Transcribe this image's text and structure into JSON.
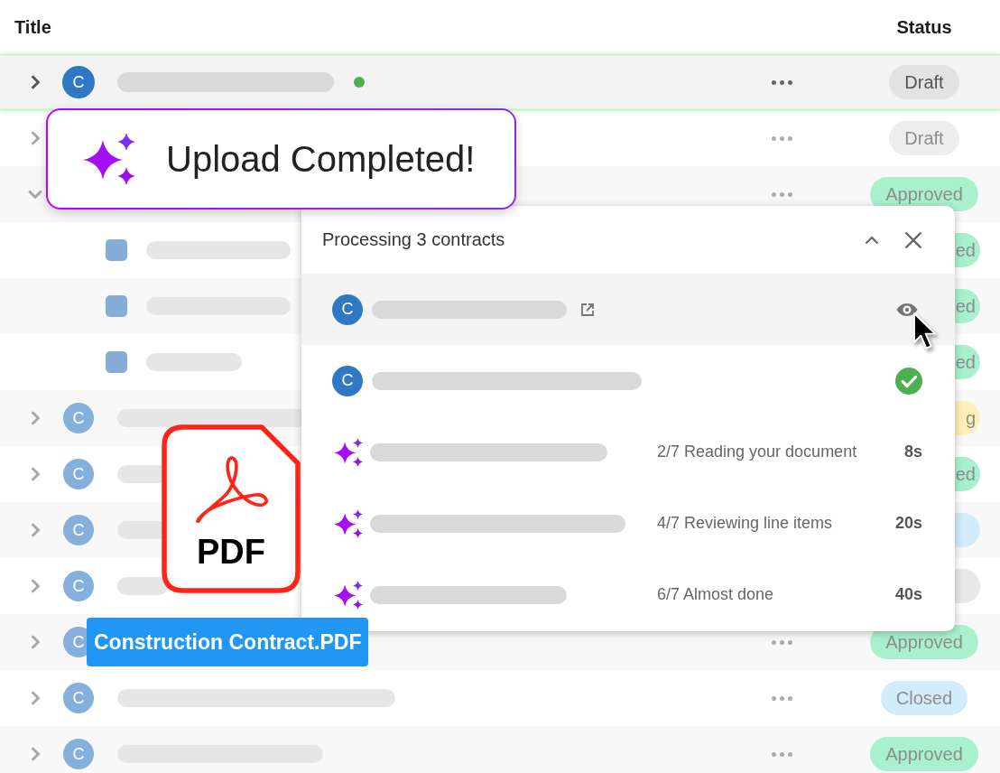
{
  "table": {
    "columns": [
      {
        "label": "Title"
      },
      {
        "label": "Status"
      }
    ],
    "rows": [
      {
        "highlighted": true,
        "expanded": false,
        "unread": true,
        "avatar": "C",
        "status": {
          "text": "Draft",
          "color": "#e3e3e3"
        }
      },
      {
        "highlighted": false,
        "expanded": false,
        "unread": false,
        "status": {
          "text": "Draft",
          "color": "#ededed"
        }
      },
      {
        "highlighted": false,
        "expanded": true,
        "unread": false,
        "status": {
          "text": "Approved",
          "color": "#a8f1cc"
        },
        "children": [
          {
            "status": {
              "text": "ed",
              "color": "#a8f1cc",
              "partial": true
            }
          },
          {
            "status": {
              "text": "ed",
              "color": "#a8f1cc",
              "partial": true
            }
          },
          {
            "status": {
              "text": "ed",
              "color": "#a8f1cc",
              "partial": true
            }
          }
        ]
      },
      {
        "highlighted": false,
        "expanded": false,
        "unread": false,
        "avatar": "C",
        "status": {
          "text": "g",
          "color": "#fbf0b9",
          "partial": true
        }
      },
      {
        "highlighted": false,
        "expanded": false,
        "unread": false,
        "avatar": "C",
        "status": {
          "text": "ed",
          "color": "#a8f1cc",
          "partial": true
        }
      },
      {
        "highlighted": false,
        "expanded": false,
        "unread": false,
        "avatar": "C",
        "status": {
          "color": "#d2ecfb",
          "partial": true
        }
      },
      {
        "highlighted": false,
        "expanded": false,
        "unread": false,
        "avatar": "C",
        "status": {
          "color": "#e8e8e8",
          "partial": true
        }
      },
      {
        "highlighted": false,
        "expanded": false,
        "unread": false,
        "avatar": "C",
        "status": {
          "text": "Approved",
          "color": "#a8f1cc"
        }
      },
      {
        "highlighted": false,
        "expanded": false,
        "unread": false,
        "avatar": "C",
        "status": {
          "text": "Closed",
          "color": "#d2ecfb"
        }
      },
      {
        "highlighted": false,
        "expanded": false,
        "unread": false,
        "avatar": "C",
        "status": {
          "text": "Approved",
          "color": "#a8f1cc"
        }
      }
    ]
  },
  "upload_toast": {
    "message": "Upload Completed!"
  },
  "processing_panel": {
    "title": "Processing 3 contracts",
    "items": [
      {
        "kind": "complete",
        "avatar": "C",
        "hovered": true
      },
      {
        "kind": "complete",
        "avatar": "C",
        "hovered": false
      },
      {
        "kind": "processing",
        "step": "2/7 Reading your document",
        "time": "8s"
      },
      {
        "kind": "processing",
        "step": "4/7 Reviewing line items",
        "time": "20s"
      },
      {
        "kind": "processing",
        "step": "6/7 Almost done",
        "time": "40s"
      }
    ]
  },
  "dragged_file": {
    "type_label": "PDF",
    "file_name": "Construction Contract.PDF"
  }
}
